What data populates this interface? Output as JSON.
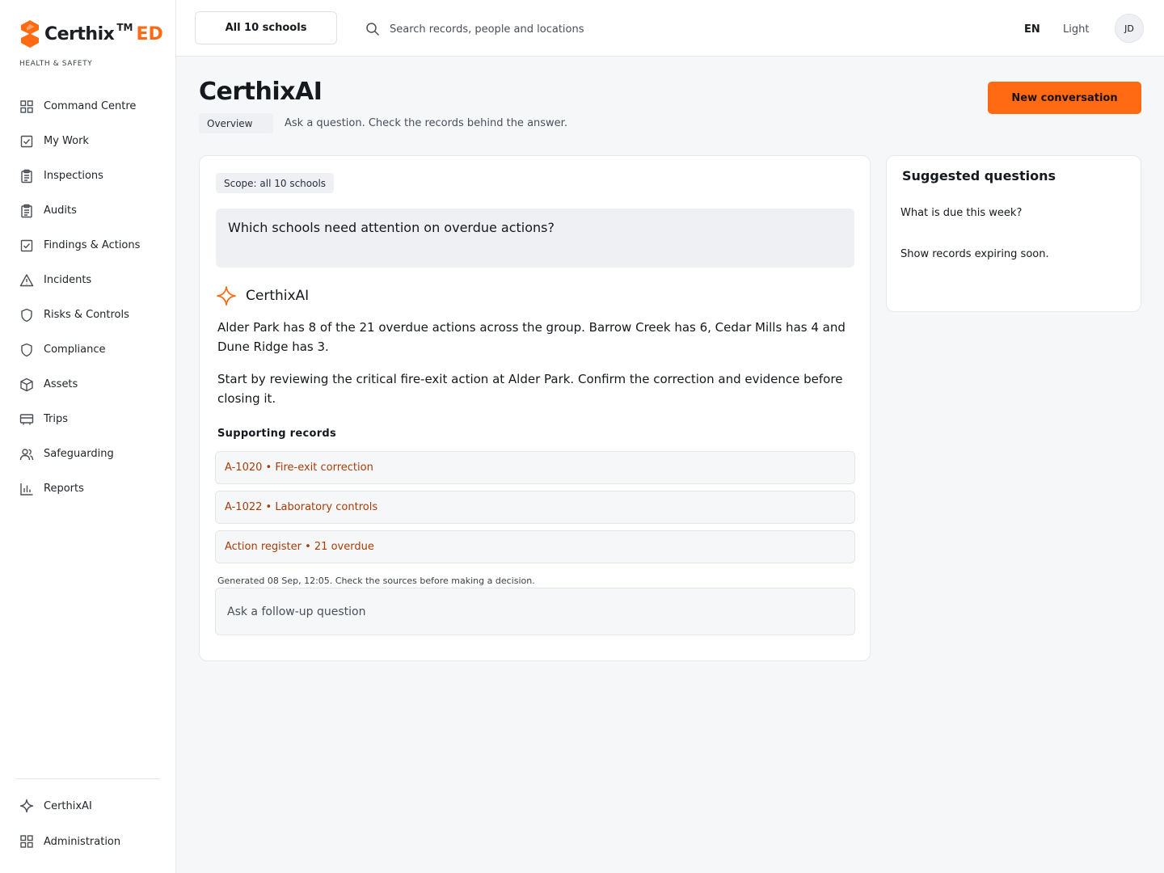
{
  "brand": {
    "name": "Certhix",
    "tm": "TM",
    "suffix": "ED",
    "subtitle": "HEALTH & SAFETY",
    "accent": "#ff6a13"
  },
  "sidebar": {
    "items": [
      {
        "label": "Command Centre",
        "icon": "grid-icon"
      },
      {
        "label": "My Work",
        "icon": "checkbox-icon"
      },
      {
        "label": "Inspections",
        "icon": "clipboard-icon"
      },
      {
        "label": "Audits",
        "icon": "clipboard-icon"
      },
      {
        "label": "Findings & Actions",
        "icon": "checkbox-icon"
      },
      {
        "label": "Incidents",
        "icon": "warning-icon"
      },
      {
        "label": "Risks & Controls",
        "icon": "shield-icon"
      },
      {
        "label": "Compliance",
        "icon": "shield-icon"
      },
      {
        "label": "Assets",
        "icon": "cube-icon"
      },
      {
        "label": "Trips",
        "icon": "bus-icon"
      },
      {
        "label": "Safeguarding",
        "icon": "users-icon"
      },
      {
        "label": "Reports",
        "icon": "bar-chart-icon"
      }
    ],
    "bottom": [
      {
        "label": "CerthixAI",
        "icon": "sparkle-icon"
      },
      {
        "label": "Administration",
        "icon": "grid-icon"
      }
    ]
  },
  "topbar": {
    "school_selector": "All 10 schools",
    "search_placeholder": "Search records, people and locations",
    "language": "EN",
    "theme": "Light",
    "avatar_initials": "JD"
  },
  "page": {
    "title": "CerthixAI",
    "tab": "Overview",
    "subtitle": "Ask a question. Check the records behind the answer.",
    "new_button": "New conversation"
  },
  "conversation": {
    "scope": "Scope: all 10 schools",
    "question": "Which schools need attention on overdue actions?",
    "assistant_name": "CerthixAI",
    "answer": [
      "Alder Park has 8 of the 21 overdue actions across the group. Barrow Creek has 6, Cedar Mills has 4 and Dune Ridge has 3.",
      "Start by reviewing the critical fire-exit action at Alder Park. Confirm the correction and evidence before closing it."
    ],
    "supporting_title": "Supporting records",
    "records": [
      "A-1020 • Fire-exit correction",
      "A-1022 • Laboratory controls",
      "Action register • 21 overdue"
    ],
    "generated": "Generated 08 Sep, 12:05. Check the sources before making a decision.",
    "followup_placeholder": "Ask a follow-up question"
  },
  "suggested": {
    "title": "Suggested questions",
    "items": [
      "What is due this week?",
      "Show records expiring soon."
    ]
  }
}
